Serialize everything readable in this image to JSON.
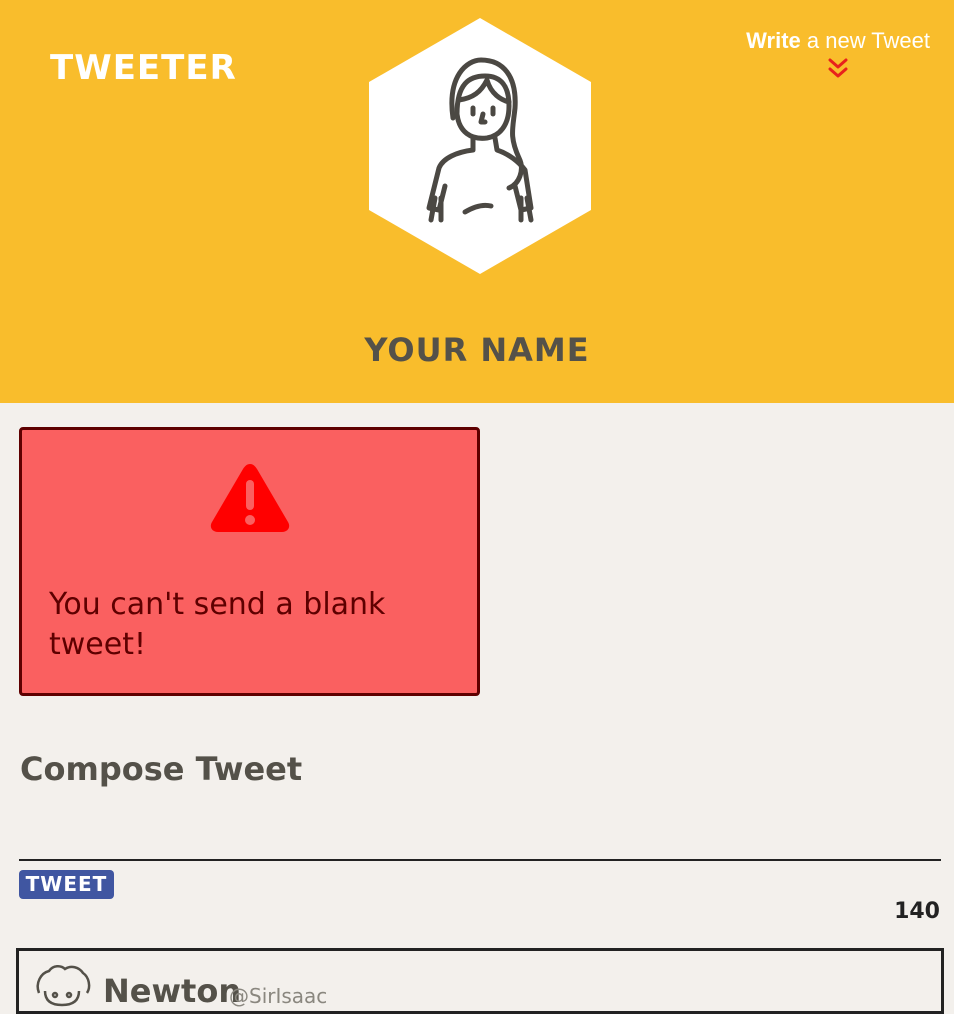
{
  "header": {
    "brand": "TWEETER",
    "write_strong": "Write",
    "write_rest": " a new Tweet",
    "profile_name": "YOUR NAME",
    "background_color": "#f9bd2c"
  },
  "icons": {
    "avatar": "woman-avatar-icon",
    "chevron": "double-chevron-down-icon",
    "warning": "warning-triangle-icon"
  },
  "error": {
    "message": "You can't send a blank tweet!",
    "background_color": "#fa6060",
    "border_color": "#5e0000"
  },
  "compose": {
    "title": "Compose Tweet",
    "input_value": "",
    "button_label": "TWEET",
    "counter": "140",
    "button_color": "#4056a1"
  },
  "tweets": [
    {
      "name": "Newton",
      "handle": "@SirIsaac"
    }
  ]
}
